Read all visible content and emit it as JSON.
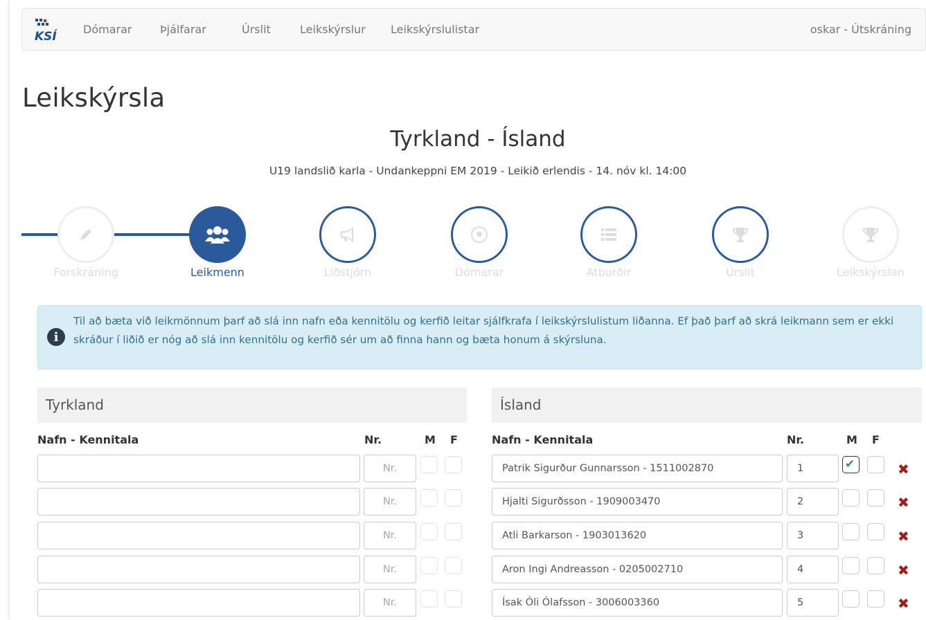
{
  "nav": {
    "brand": "KSÍ",
    "items": [
      "Dómarar",
      "Þjálfarar",
      "Úrslit",
      "Leikskýrslur",
      "Leikskýrslulistar"
    ],
    "user": "oskar - Útskráning"
  },
  "page": {
    "title": "Leikskýrsla",
    "match_title": "Tyrkland - Ísland",
    "match_subtitle": "U19 landslið karla - Undankeppni EM 2019 - Leikið erlendis - 14. nóv kl. 14:00"
  },
  "steps": [
    {
      "label": "Forskráning",
      "icon": "pencil-icon",
      "state": "done"
    },
    {
      "label": "Leikmenn",
      "icon": "users-icon",
      "state": "active"
    },
    {
      "label": "Liðstjórn",
      "icon": "megaphone-icon",
      "state": "pending"
    },
    {
      "label": "Dómarar",
      "icon": "soccer-ball-icon",
      "state": "pending"
    },
    {
      "label": "Atburðir",
      "icon": "list-icon",
      "state": "pending"
    },
    {
      "label": "Úrslit",
      "icon": "trophy-icon",
      "state": "pending"
    },
    {
      "label": "Leikskýrslan",
      "icon": "trophy-icon",
      "state": "disabled"
    }
  ],
  "info": {
    "icon": "info-icon",
    "text": "Til að bæta við leikmönnum þarf að slá inn nafn eða kennitölu og kerfið leitar sjálfkrafa í leikskýrslulistum liðanna. Ef það þarf að skrá leikmann sem er ekki skráður í liðið er nóg að slá inn kennitölu og kerfið sér um að finna hann og bæta honum á skýrsluna."
  },
  "columns": {
    "name": "Nafn - Kennitala",
    "nr": "Nr.",
    "m": "M",
    "f": "F",
    "nr_placeholder": "Nr."
  },
  "home": {
    "name": "Tyrkland",
    "players": [
      {
        "name": "",
        "nr": ""
      },
      {
        "name": "",
        "nr": ""
      },
      {
        "name": "",
        "nr": ""
      },
      {
        "name": "",
        "nr": ""
      },
      {
        "name": "",
        "nr": ""
      }
    ]
  },
  "away": {
    "name": "Ísland",
    "players": [
      {
        "name": "Patrik Sigurður Gunnarsson - 1511002870",
        "nr": "1",
        "m": true,
        "f": false
      },
      {
        "name": "Hjalti Sigurðsson - 1909003470",
        "nr": "2",
        "m": false,
        "f": false
      },
      {
        "name": "Atli Barkarson - 1903013620",
        "nr": "3",
        "m": false,
        "f": false
      },
      {
        "name": "Aron Ingi Andreasson - 0205002710",
        "nr": "4",
        "m": false,
        "f": false
      },
      {
        "name": "Ísak Óli Ólafsson - 3006003360",
        "nr": "5",
        "m": false,
        "f": false
      }
    ]
  },
  "colors": {
    "primary": "#2b5a9a",
    "info_bg": "#d9edf7",
    "info_text": "#31708f",
    "check": "#3c9a3c",
    "remove": "#a31d1d"
  }
}
